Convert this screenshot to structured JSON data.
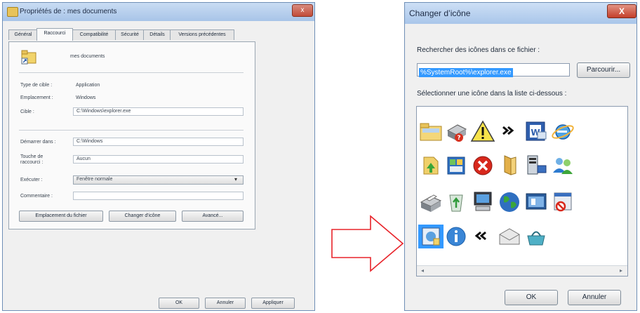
{
  "properties_window": {
    "title": "Propriétés de : mes documents",
    "close_label": "x",
    "tabs": [
      "Général",
      "Raccourci",
      "Compatibilité",
      "Sécurité",
      "Détails",
      "Versions précédentes"
    ],
    "active_tab": "Raccourci",
    "shortcut_name": "mes documents",
    "fields": {
      "type_label": "Type de cible :",
      "type_value": "Application",
      "location_label": "Emplacement :",
      "location_value": "Windows",
      "target_label": "Cible :",
      "target_value": "C:\\Windows\\explorer.exe",
      "start_in_label": "Démarrer dans :",
      "start_in_value": "C:\\Windows",
      "shortcut_key_label_1": "Touche de",
      "shortcut_key_label_2": "raccourci :",
      "shortcut_key_value": "Aucun",
      "run_label": "Exécuter :",
      "run_value": "Fenêtre normale",
      "comment_label": "Commentaire :",
      "comment_value": ""
    },
    "buttons": {
      "open_location": "Emplacement du fichier",
      "change_icon": "Changer d'icône",
      "advanced": "Avancé..."
    },
    "footer_buttons": {
      "ok": "OK",
      "cancel": "Annuler",
      "apply": "Appliquer"
    }
  },
  "change_icon_window": {
    "title": "Changer d’icône",
    "close_label": "X",
    "search_label": "Rechercher des icônes dans ce fichier :",
    "path_value": "%SystemRoot%\\explorer.exe",
    "browse_button": "Parcourir...",
    "select_label": "Sélectionner une icône dans la liste ci-dessous :",
    "icons": [
      [
        "folder-icon",
        "printer-help-icon",
        "warning-icon",
        "double-chevron-right-icon",
        "word-document-icon",
        "internet-explorer-icon"
      ],
      [
        "folder-up-icon",
        "control-panel-icon",
        "error-icon",
        "folder-closed-icon",
        "server-icon",
        "users-icon"
      ],
      [
        "printer-icon",
        "recycle-bin-icon",
        "computer-icon",
        "globe-icon",
        "network-window-icon",
        "disabled-window-icon"
      ],
      [
        "explorer-selected-icon",
        "info-icon",
        "double-chevron-left-icon",
        "mail-icon",
        "basket-icon"
      ]
    ],
    "selected_icon": "explorer-selected-icon",
    "ok_button": "OK",
    "cancel_button": "Annuler"
  },
  "colors": {
    "selection": "#3399ff",
    "arrow_stroke": "#e8232a"
  }
}
